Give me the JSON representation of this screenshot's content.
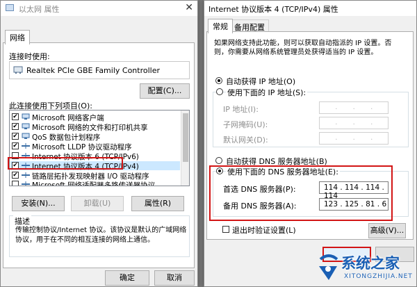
{
  "left_window": {
    "title": "以太网 属性",
    "tab": "网络",
    "connect_using_label": "连接时使用:",
    "adapter_name": "Realtek PCIe GBE Family Controller",
    "configure_button": "配置(C)...",
    "items_label": "此连接使用下列项目(O):",
    "items": [
      {
        "text": "Microsoft 网络客户端",
        "checked": true,
        "icon": "network-client-icon"
      },
      {
        "text": "Microsoft 网络的文件和打印机共享",
        "checked": true,
        "icon": "file-share-icon"
      },
      {
        "text": "QoS 数据包计划程序",
        "checked": true,
        "icon": "qos-icon"
      },
      {
        "text": "Microsoft LLDP 协议驱动程序",
        "checked": true,
        "icon": "protocol-icon"
      },
      {
        "text": "Internet 协议版本 6 (TCP/IPv6)",
        "checked": false,
        "icon": "protocol-icon"
      },
      {
        "text": "Internet 协议版本 4 (TCP/IPv4)",
        "checked": true,
        "icon": "protocol-icon"
      },
      {
        "text": "链路层拓扑发现映射器 I/O 驱动程序",
        "checked": true,
        "icon": "protocol-icon"
      },
      {
        "text": "Microsoft 网络适配器多路传送器协议",
        "checked": false,
        "icon": "protocol-icon"
      }
    ],
    "install_button": "安装(N)...",
    "uninstall_button": "卸载(U)",
    "properties_button": "属性(R)",
    "description_label": "描述",
    "description_text": "传输控制协议/Internet 协议。该协议是默认的广域网络协议，用于在不同的相互连接的网络上通信。",
    "ok_button": "确定",
    "cancel_button": "取消"
  },
  "right_window": {
    "title": "Internet 协议版本 4 (TCP/IPv4) 属性",
    "tabs": [
      "常规",
      "备用配置"
    ],
    "info_text": "如果网络支持此功能，则可以获取自动指派的 IP 设置。否则，你需要从网络系统管理员处获得适当的 IP 设置。",
    "auto_ip_label": "自动获得 IP 地址(O)",
    "manual_ip_label": "使用下面的 IP 地址(S):",
    "ip_address_label": "IP 地址(I):",
    "subnet_label": "子网掩码(U):",
    "gateway_label": "默认网关(D):",
    "auto_dns_label": "自动获得 DNS 服务器地址(B)",
    "manual_dns_label": "使用下面的 DNS 服务器地址(E):",
    "preferred_dns_label": "首选 DNS 服务器(P):",
    "preferred_dns_value": "114 . 114 . 114 . 114",
    "alternate_dns_label": "备用 DNS 服务器(A):",
    "alternate_dns_value": "123 . 125 .  81 .  6",
    "validate_label": "退出时验证设置(L)",
    "advanced_button": "高级(V)..."
  },
  "watermark": {
    "brand": "系统之家",
    "url": "XITONGZHIJIA.NET"
  },
  "colors": {
    "highlight_red": "#d21414",
    "selection_blue": "#cce8ff",
    "watermark_blue": "#1a5fb4"
  }
}
